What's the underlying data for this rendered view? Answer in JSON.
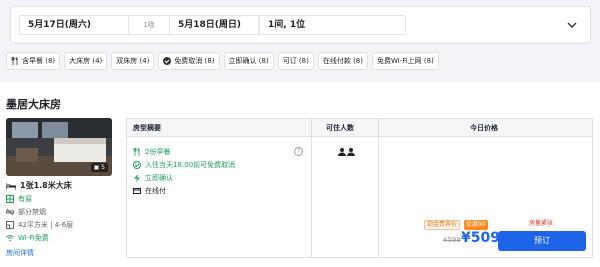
{
  "search": {
    "checkin": "5月17日(周六)",
    "nights": "1晚",
    "checkout": "5月18日(周日)",
    "rooms_guests": "1间, 1位"
  },
  "filters": [
    {
      "label": "含早餐 (8)",
      "icon": "fork-knife-icon"
    },
    {
      "label": "大床房 (4)",
      "icon": ""
    },
    {
      "label": "双床房 (4)",
      "icon": ""
    },
    {
      "label": "免费取消 (8)",
      "icon": "check-circle-icon"
    },
    {
      "label": "立即确认 (8)",
      "icon": ""
    },
    {
      "label": "可订 (8)",
      "icon": ""
    },
    {
      "label": "在线付款 (8)",
      "icon": ""
    },
    {
      "label": "免费Wi-Fi上网 (8)",
      "icon": ""
    }
  ],
  "room": {
    "title": "墨居大床房",
    "photo_count": "5",
    "bed": "1张1.8米大床",
    "attributes": [
      {
        "label": "有窗",
        "icon": "window-icon",
        "color": "#1f9e5a"
      },
      {
        "label": "部分禁烟",
        "icon": "no-smoking-icon",
        "color": "#5f6368"
      },
      {
        "label": "42平方米 | 4-6层",
        "icon": "area-icon",
        "color": "#5f6368"
      },
      {
        "label": "Wi-Fi免费",
        "icon": "wifi-icon",
        "color": "#1f9e5a"
      }
    ],
    "detail_link": "房间详情"
  },
  "table": {
    "col_summary": "房型摘要",
    "col_occupancy": "可住人数",
    "col_price": "今日价格",
    "features": [
      {
        "label": "2份早餐",
        "icon": "fork-knife-icon",
        "color": "#1f9e5a"
      },
      {
        "label": "入住当天18:00前可免费取消",
        "icon": "check-circle-icon",
        "color": "#1f9e5a"
      },
      {
        "label": "立即确认",
        "icon": "lightning-icon",
        "color": "#1f9e5a"
      },
      {
        "label": "在线付",
        "icon": "card-icon",
        "color": "#1f2329"
      }
    ],
    "help_glyph": "?",
    "rate": {
      "badge_hot": "房量紧张",
      "badge_member": "铂金贵宾价",
      "badge_discount": "优惠90",
      "old_price": "¥599",
      "price": "¥509",
      "book_label": "预订"
    }
  },
  "colors": {
    "accent": "#1d64e8",
    "green": "#1f9e5a",
    "orange": "#ff8a1f",
    "red": "#d93025"
  }
}
